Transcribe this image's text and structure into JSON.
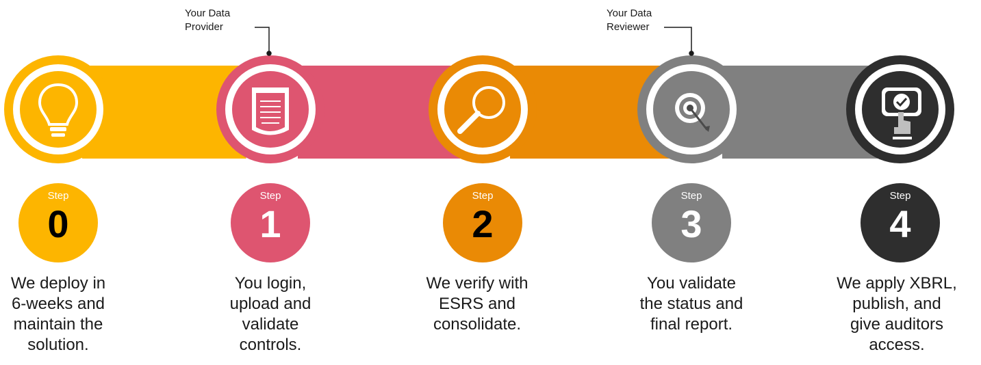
{
  "callouts": {
    "provider": "Your Data\nProvider",
    "reviewer": "Your Data\nReviewer"
  },
  "colors": {
    "yellow": "#FDB500",
    "pink": "#DE5570",
    "orange": "#EA8A05",
    "gray": "#808080",
    "black": "#2E2E2E"
  },
  "steps": [
    {
      "word": "Step",
      "number": "0",
      "icon": "lightbulb-icon",
      "number_color": "#000000",
      "description": "We deploy in\n6-weeks and\nmaintain the\nsolution."
    },
    {
      "word": "Step",
      "number": "1",
      "icon": "clipboard-icon",
      "number_color": "#ffffff",
      "description": "You login,\nupload and\nvalidate\ncontrols."
    },
    {
      "word": "Step",
      "number": "2",
      "icon": "magnifier-icon",
      "number_color": "#000000",
      "description": "We verify with\nESRS and\nconsolidate."
    },
    {
      "word": "Step",
      "number": "3",
      "icon": "target-icon",
      "number_color": "#ffffff",
      "description": "You validate\nthe status and\nfinal report."
    },
    {
      "word": "Step",
      "number": "4",
      "icon": "checkmark-screen-icon",
      "number_color": "#ffffff",
      "description": "We apply XBRL,\npublish, and\ngive auditors\naccess."
    }
  ]
}
